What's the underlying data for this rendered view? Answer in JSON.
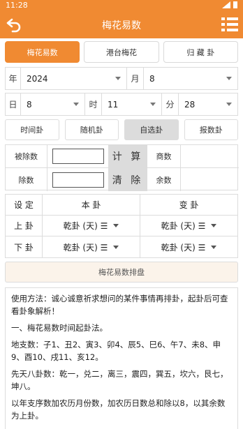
{
  "status": {
    "time": "11:28"
  },
  "header": {
    "title": "梅花易数"
  },
  "tabs": [
    {
      "label": "梅花易数",
      "active": true
    },
    {
      "label": "港台梅花",
      "active": false
    },
    {
      "label": "归 藏 卦",
      "active": false
    }
  ],
  "date": {
    "year_label": "年",
    "year_value": "2024",
    "month_label": "月",
    "month_value": "8",
    "day_label": "日",
    "day_value": "8",
    "hour_label": "时",
    "hour_value": "11",
    "minute_label": "分",
    "minute_value": "28"
  },
  "modes": [
    {
      "label": "时间卦",
      "active": false
    },
    {
      "label": "随机卦",
      "active": false
    },
    {
      "label": "自选卦",
      "active": true
    },
    {
      "label": "报数卦",
      "active": false
    }
  ],
  "calc": {
    "dividend_label": "被除数",
    "dividend_value": "",
    "divisor_label": "除数",
    "divisor_value": "",
    "compute_label": "计 算",
    "clear_label": "清 除",
    "quotient_label": "商数",
    "remainder_label": "余数"
  },
  "gua": {
    "header": {
      "setting": "设 定",
      "ben": "本 卦",
      "bian": "变 卦"
    },
    "upper_label": "上 卦",
    "lower_label": "下 卦",
    "upper_ben": "乾卦 (天) ☰",
    "upper_bian": "乾卦 (天) ☰",
    "lower_ben": "乾卦 (天) ☰",
    "lower_bian": "乾卦 (天) ☰"
  },
  "pan_button": "梅花易数排盘",
  "info": {
    "p1": "使用方法：诚心诚意祈求想问的某件事情再排卦，起卦后可查看卦象解析！",
    "p2": "一、梅花易数时间起卦法。",
    "p3": "地支数：子1、丑2、寅3、卯4、辰5、巳6、午7、未8、申9、酉10、戌11、亥12。",
    "p4": "先天八卦数：乾一，兑二，离三，震四，巽五，坎六，艮七，坤八。",
    "p5": "以年支序数加农历月份数，加农历日数总和除以8，以其余数为上卦。"
  }
}
